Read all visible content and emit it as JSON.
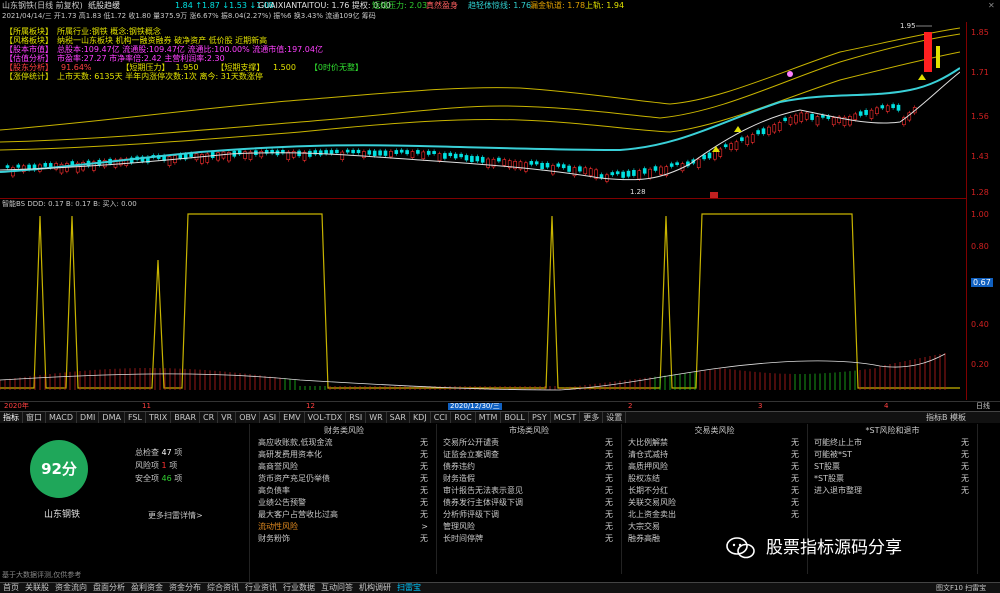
{
  "titlebar": {
    "title": "山东钢铁(日线 前复权)",
    "indicator": "纸股趋缓",
    "stats_left": "1.84  ↑1.87  ↓1.53  ↓1.08",
    "stats_mid": "GUAIXIANTAITOU: 1.76  提权: 0.00",
    "signal1_label": "短线压力: 2.03",
    "signal2_label": "真然盈身",
    "signal3_label": "趋轻体惊线: 1.76",
    "signal4_label": "漏金轨道: 1.78",
    "signal5_label": "上轨: 1.94"
  },
  "infobar": {
    "text": "2021/04/14/三  开1.73  高1.83  低1.72  收1.80  量375.9万  涨6.67%  振8.04(2.27%)  振%6  换3.43%  流通109亿  筹码"
  },
  "legend": {
    "line1_label": "【所属板块】",
    "line1_value": "所属行业:钢铁  概念:钢铁概念",
    "line2_label": "【风格板块】",
    "line2_value": "纳税一山东板块  机构一融资融券  破净资产  低价股  近期新高",
    "line3_label": "【股本市值】",
    "line3_value": "总股本:109.47亿  流通股:109.47亿  流通比:100.00%  流通市值:197.04亿",
    "line4_label": "【估值分析】",
    "line4_value": "市盈率:27.27  市净率倍:2.42  主营利润率:2.30",
    "line5_label": "【股东分析】",
    "line5_value": "91.64%",
    "line5_mid": "【短期压力】",
    "line5_mid_value": "1.950",
    "line5_right": "【短期支撑】",
    "line5_right_value": "1.500",
    "line5_tag": "【0时价无整】",
    "line6_label": "【涨停统计】",
    "line6_value": "上市天数: 6135天  半年内涨停次数:1次  离今: 31天数涨停"
  },
  "main_axis": [
    "1.85",
    "1.71",
    "1.56",
    "1.43",
    "1.28"
  ],
  "main_annotations": {
    "high_label": "1.95",
    "low_label": "1.28"
  },
  "indicator": {
    "header": "智能BS DDD: 0.17  B: 0.17  B:    买入: 0.00",
    "axis": [
      "1.00",
      "0.80",
      "0.67",
      "0.40",
      "0.20"
    ],
    "current_value": "0.67"
  },
  "datebar": {
    "labels": [
      "2020年",
      "11",
      "12",
      "2020/12/30/三",
      "2",
      "3",
      "4"
    ],
    "right": "日线"
  },
  "tabs": [
    "指标",
    "窗口",
    "MACD",
    "DMI",
    "DMA",
    "FSL",
    "TRIX",
    "BRAR",
    "CR",
    "VR",
    "OBV",
    "ASI",
    "EMV",
    "VOL-TDX",
    "RSI",
    "WR",
    "SAR",
    "KDJ",
    "CCI",
    "ROC",
    "MTM",
    "BOLL",
    "PSY",
    "MCST",
    "更多",
    "设置"
  ],
  "tabs_right": "指标B 模板",
  "score": {
    "value": "92分",
    "stock_name": "山东钢铁",
    "total_label": "总检查",
    "total_value": "47",
    "total_unit": "项",
    "risk_label": "风险项",
    "risk_value": "1",
    "risk_unit": "项",
    "safe_label": "安全项",
    "safe_value": "46",
    "safe_unit": "项",
    "more_link": "更多扫雷详情>",
    "footnote": "基于大数据评测,仅供参考"
  },
  "risk_columns": [
    {
      "title": "财务类风险",
      "items": [
        {
          "label": "高应收账款,低现金流",
          "v": "无"
        },
        {
          "label": "高研发费用资本化",
          "v": "无"
        },
        {
          "label": "高商誉风险",
          "v": "无"
        },
        {
          "label": "货币资产充足仍举债",
          "v": "无"
        },
        {
          "label": "高负债率",
          "v": "无"
        },
        {
          "label": "业绩公告预警",
          "v": "无"
        },
        {
          "label": "最大客户占营收比过高",
          "v": "无"
        },
        {
          "label": "流动性风险",
          "v": ">",
          "orange": true
        },
        {
          "label": "财务粉饰",
          "v": "无"
        }
      ]
    },
    {
      "title": "市场类风险",
      "items": [
        {
          "label": "交易所公开谴责",
          "v": "无"
        },
        {
          "label": "证监会立案调查",
          "v": "无"
        },
        {
          "label": "债券违约",
          "v": "无"
        },
        {
          "label": "财务造假",
          "v": "无"
        },
        {
          "label": "审计报告无法表示意见",
          "v": "无"
        },
        {
          "label": "债券发行主体评级下调",
          "v": "无"
        },
        {
          "label": "分析师评级下调",
          "v": "无"
        },
        {
          "label": "管理风险",
          "v": "无"
        },
        {
          "label": "长时间停牌",
          "v": "无"
        }
      ]
    },
    {
      "title": "交易类风险",
      "items": [
        {
          "label": "大比例解禁",
          "v": "无"
        },
        {
          "label": "清仓式减持",
          "v": "无"
        },
        {
          "label": "高质押风险",
          "v": "无"
        },
        {
          "label": "股权冻结",
          "v": "无"
        },
        {
          "label": "长期不分红",
          "v": "无"
        },
        {
          "label": "关联交易风险",
          "v": "无"
        },
        {
          "label": "北上资金卖出",
          "v": "无"
        },
        {
          "label": "大宗交易",
          "v": ""
        },
        {
          "label": "融券高融",
          "v": ""
        }
      ]
    },
    {
      "title": "*ST风险和退市",
      "items": [
        {
          "label": "可能终止上市",
          "v": "无"
        },
        {
          "label": "可能被*ST",
          "v": "无"
        },
        {
          "label": "ST股票",
          "v": "无"
        },
        {
          "label": "*ST股票",
          "v": "无"
        },
        {
          "label": "进入退市整理",
          "v": "无"
        }
      ]
    }
  ],
  "watermark": "股票指标源码分享",
  "bottom_tabs": [
    "首页",
    "关联股",
    "资金流向",
    "盘面分析",
    "盈利资金",
    "资金分布",
    "综合资讯",
    "行业资讯",
    "行业数据",
    "互动问答",
    "机构调研",
    "扫雷宝"
  ],
  "bottom_right": "图文F10 扫雷宝",
  "colors": {
    "up": "#ff3030",
    "down": "#00e0e0",
    "band": "#c8b400",
    "ma": "#3ad0d8",
    "score_bg": "#1fa75a"
  }
}
